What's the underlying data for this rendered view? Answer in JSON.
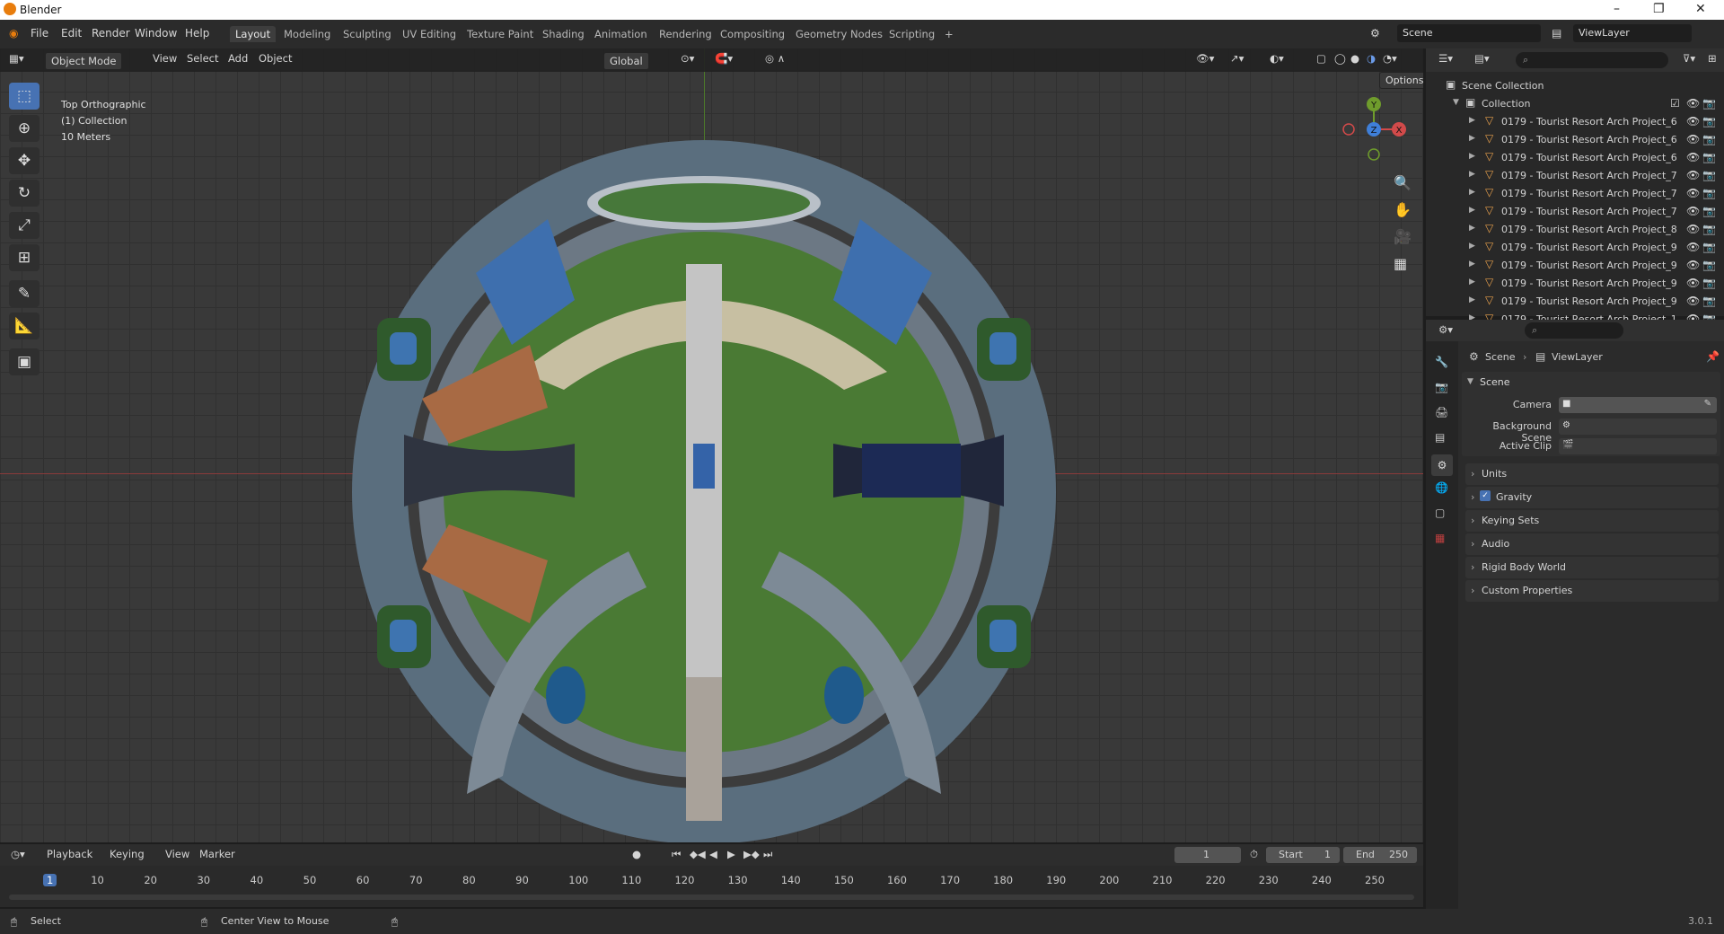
{
  "app": {
    "title": "Blender",
    "version": "3.0.1"
  },
  "menu": [
    "File",
    "Edit",
    "Render",
    "Window",
    "Help"
  ],
  "workspaces": [
    {
      "label": "Layout",
      "active": true
    },
    {
      "label": "Modeling"
    },
    {
      "label": "Sculpting"
    },
    {
      "label": "UV Editing"
    },
    {
      "label": "Texture Paint"
    },
    {
      "label": "Shading"
    },
    {
      "label": "Animation"
    },
    {
      "label": "Rendering"
    },
    {
      "label": "Compositing"
    },
    {
      "label": "Geometry Nodes"
    },
    {
      "label": "Scripting"
    }
  ],
  "scene_field": "Scene",
  "viewlayer_field": "ViewLayer",
  "viewport_header": {
    "mode": "Object Mode",
    "menus": [
      "View",
      "Select",
      "Add",
      "Object"
    ],
    "transform": "Global",
    "options": "Options"
  },
  "viewport_overlay": {
    "view": "Top Orthographic",
    "collection": "(1) Collection",
    "scale": "10 Meters"
  },
  "gizmo": {
    "x": "X",
    "y": "Y",
    "z": "Z"
  },
  "outliner": {
    "root": "Scene Collection",
    "collection": "Collection",
    "items": [
      "0179 - Tourist Resort Arch Project_6",
      "0179 - Tourist Resort Arch Project_6",
      "0179 - Tourist Resort Arch Project_6",
      "0179 - Tourist Resort Arch Project_7",
      "0179 - Tourist Resort Arch Project_7",
      "0179 - Tourist Resort Arch Project_7",
      "0179 - Tourist Resort Arch Project_8",
      "0179 - Tourist Resort Arch Project_9",
      "0179 - Tourist Resort Arch Project_9",
      "0179 - Tourist Resort Arch Project_9",
      "0179 - Tourist Resort Arch Project_9",
      "0179 - Tourist Resort Arch Project_1"
    ]
  },
  "properties": {
    "breadcrumb_scene": "Scene",
    "breadcrumb_viewlayer": "ViewLayer",
    "section": "Scene",
    "camera_label": "Camera",
    "background_label": "Background Scene",
    "clip_label": "Active Clip",
    "panels": [
      "Units",
      "Gravity",
      "Keying Sets",
      "Audio",
      "Rigid Body World",
      "Custom Properties"
    ]
  },
  "timeline": {
    "menus": [
      "Playback",
      "Keying",
      "View",
      "Marker"
    ],
    "current_frame": "1",
    "start_label": "Start",
    "start": "1",
    "end_label": "End",
    "end": "250",
    "ticks": [
      "1",
      "10",
      "20",
      "30",
      "40",
      "50",
      "60",
      "70",
      "80",
      "90",
      "100",
      "110",
      "120",
      "130",
      "140",
      "150",
      "160",
      "170",
      "180",
      "190",
      "200",
      "210",
      "220",
      "230",
      "240",
      "250"
    ]
  },
  "status": {
    "left": "Select",
    "middle": "Center View to Mouse"
  },
  "colors": {
    "accent": "#4772b3",
    "outliner_icon": "#e8a04c",
    "grass": "#4a7a34",
    "water": "#3b6ea8",
    "plaza": "#5a6e7e"
  }
}
